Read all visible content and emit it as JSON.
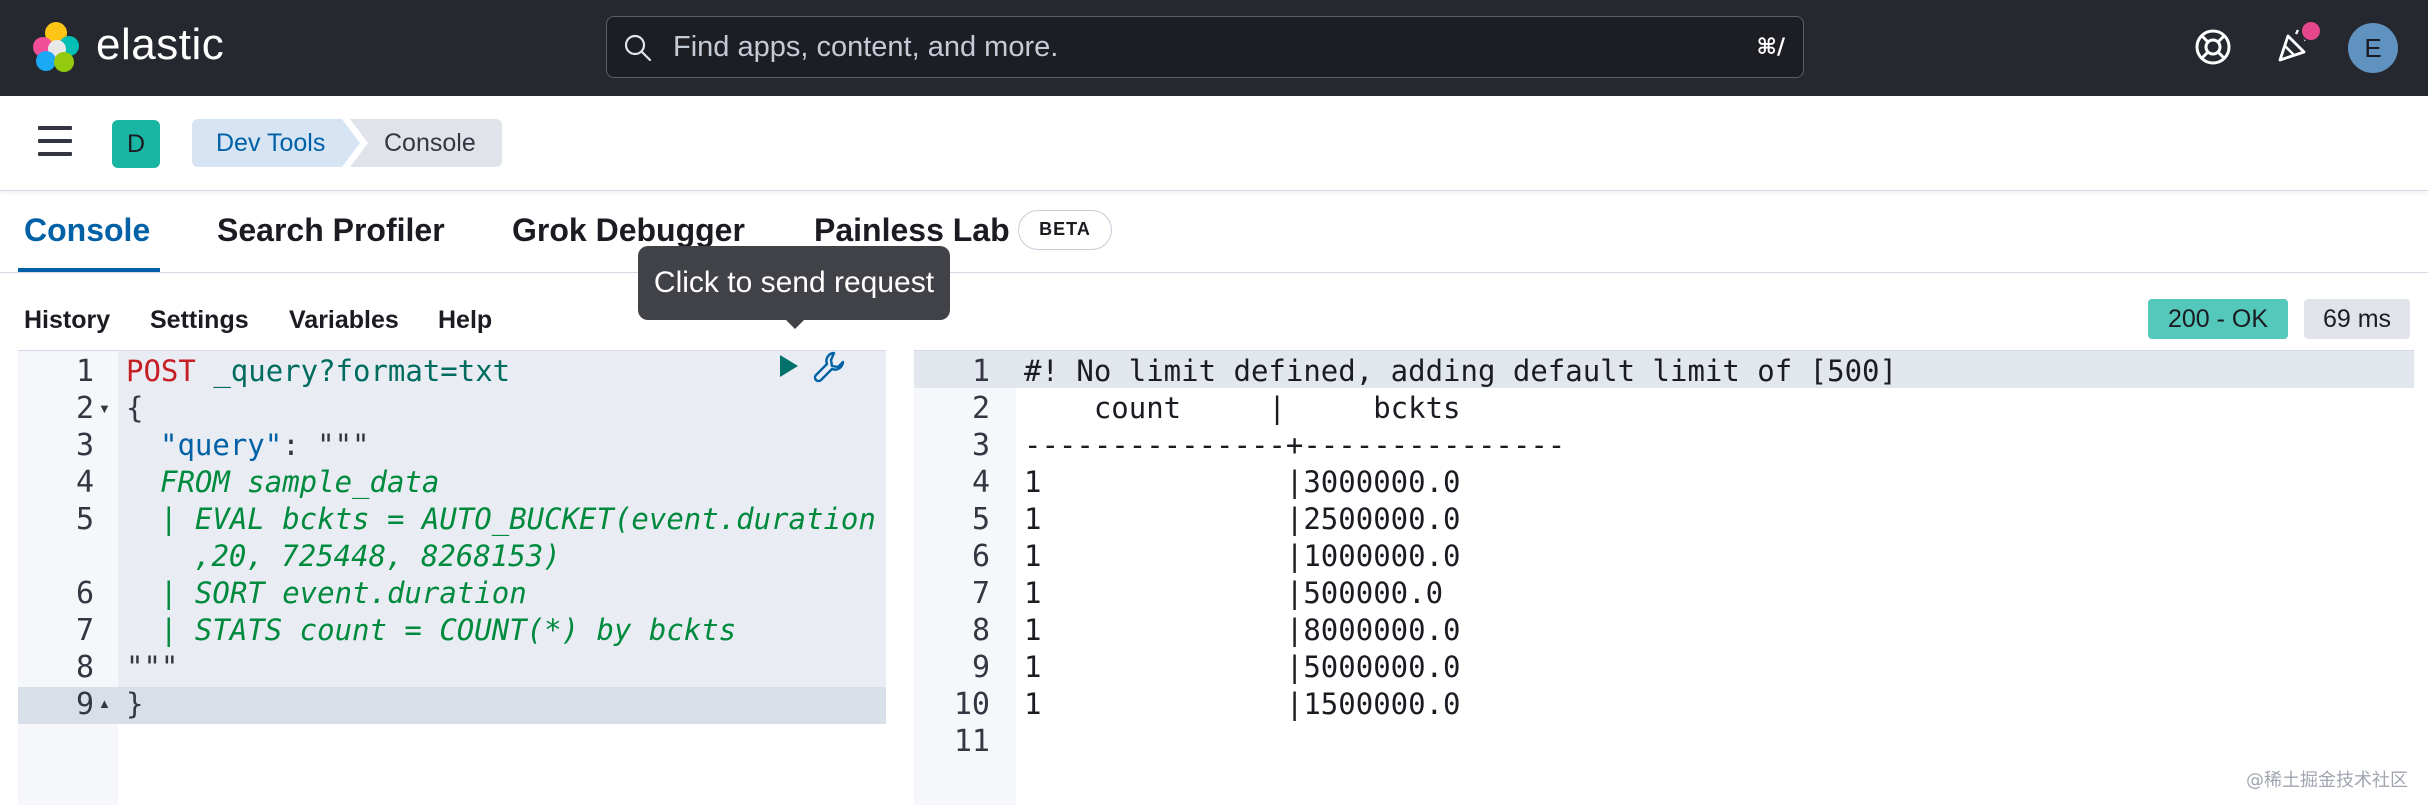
{
  "header": {
    "brand": "elastic",
    "search_placeholder": "Find apps, content, and more.",
    "search_shortcut": "⌘/",
    "user_initial": "E",
    "icons": [
      "elastic-logo-icon",
      "search-icon",
      "help-icon",
      "news-feed-icon"
    ]
  },
  "breadcrumbs": {
    "space_initial": "D",
    "items": [
      "Dev Tools",
      "Console"
    ]
  },
  "tabs": [
    {
      "label": "Console",
      "active": true
    },
    {
      "label": "Search Profiler",
      "active": false
    },
    {
      "label": "Grok Debugger",
      "active": false
    },
    {
      "label": "Painless Lab",
      "active": false,
      "badge": "BETA"
    }
  ],
  "toolbar": {
    "items": [
      "History",
      "Settings",
      "Variables",
      "Help"
    ],
    "tooltip": "Click to send request",
    "status": "200 - OK",
    "duration": "69 ms"
  },
  "request": {
    "line_numbers": [
      "1",
      "2",
      "3",
      "4",
      "5",
      "6",
      "7",
      "8",
      "9"
    ],
    "method": "POST",
    "url": "_query?format=txt",
    "open_brace": "{",
    "query_key": "\"query\"",
    "query_colon": ": ",
    "triple_quote_open": "\"\"\"",
    "esql_lines": [
      "FROM sample_data",
      "| EVAL bckts = AUTO_BUCKET(event.duration",
      ",20, 725448, 8268153)",
      "| SORT event.duration",
      "| STATS count = COUNT(*) by bckts"
    ],
    "triple_quote_close": "\"\"\"",
    "close_brace": "}"
  },
  "response": {
    "line_numbers": [
      "1",
      "2",
      "3",
      "4",
      "5",
      "6",
      "7",
      "8",
      "9",
      "10",
      "11"
    ],
    "lines": [
      "#! No limit defined, adding default limit of [500]",
      "    count     |     bckts",
      "---------------+---------------",
      "1              |3000000.0",
      "1              |2500000.0",
      "1              |1000000.0",
      "1              |500000.0",
      "1              |8000000.0",
      "1              |5000000.0",
      "1              |1500000.0",
      ""
    ]
  },
  "watermark": "@稀土掘金技术社区",
  "colors": {
    "header_bg": "#25282f",
    "accent": "#0061a6",
    "status_ok": "#54c8ba",
    "method": "#c61e25",
    "esql": "#008a3d"
  }
}
